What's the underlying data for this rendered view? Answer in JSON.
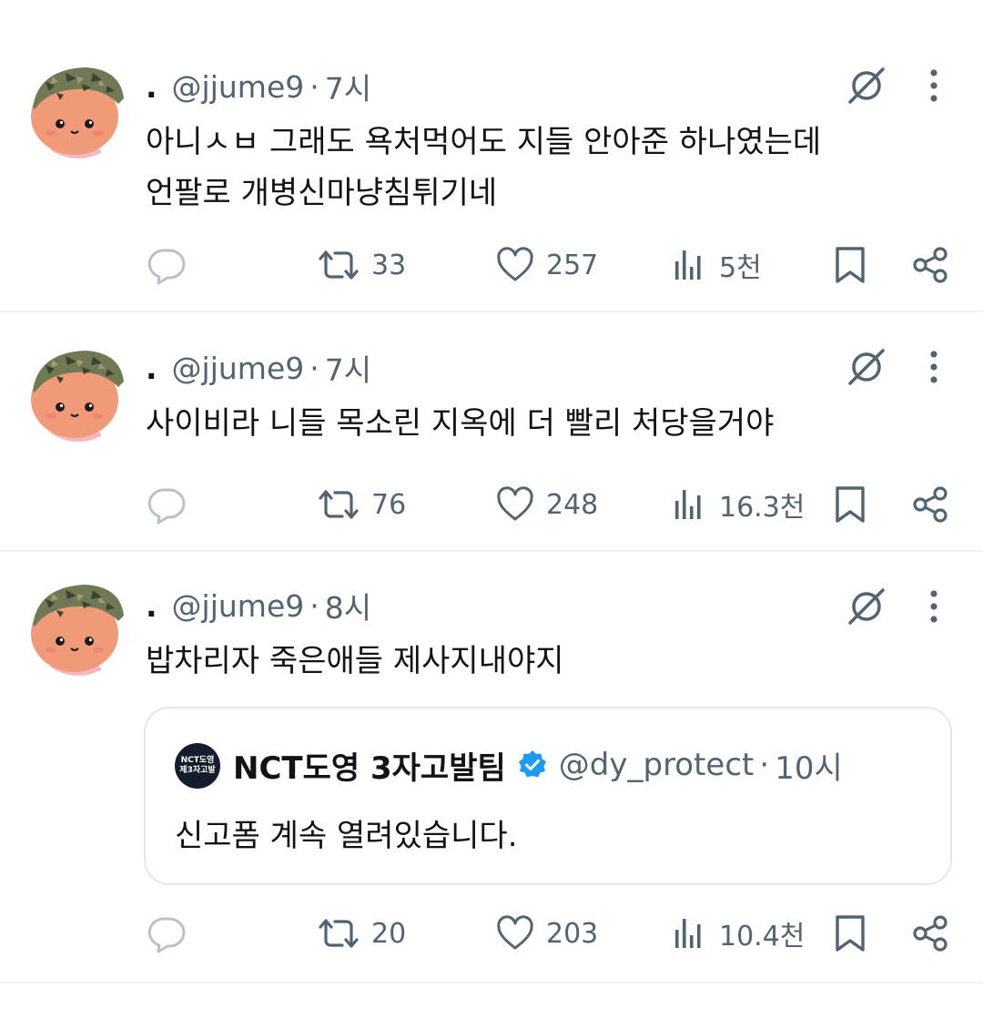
{
  "tweets": [
    {
      "display_name": ".",
      "handle": "@jjume9",
      "separator": "·",
      "time": "7시",
      "lines": [
        "아니ㅅㅂ 그래도 욕처먹어도 지들 안아준 하나였는데",
        "언팔로 개병신마냥침튀기네"
      ],
      "reply_count": "",
      "retweet_count": "33",
      "like_count": "257",
      "views_count": "5천"
    },
    {
      "display_name": ".",
      "handle": "@jjume9",
      "separator": "·",
      "time": "7시",
      "lines": [
        "사이비라 니들 목소린 지옥에 더 빨리 처당을거야"
      ],
      "reply_count": "",
      "retweet_count": "76",
      "like_count": "248",
      "views_count": "16.3천"
    },
    {
      "display_name": ".",
      "handle": "@jjume9",
      "separator": "·",
      "time": "8시",
      "lines": [
        "밥차리자 죽은애들 제사지내야지"
      ],
      "quote": {
        "avatar_line1": "NCT도영",
        "avatar_line2": "제3자고발",
        "display_name": "NCT도영 3자고발팀",
        "handle": "@dy_protect",
        "separator": "·",
        "time": "10시",
        "text": "신고폼 계속 열려있습니다."
      },
      "reply_count": "",
      "retweet_count": "20",
      "like_count": "203",
      "views_count": "10.4천"
    }
  ],
  "icons": {
    "reply": "reply-icon",
    "retweet": "retweet-icon",
    "like": "heart-icon",
    "views": "views-icon",
    "bookmark": "bookmark-icon",
    "share": "share-icon",
    "grok": "grok-icon",
    "more": "more-icon",
    "verified": "verified-badge-icon"
  },
  "colors": {
    "text_primary": "#0f1419",
    "text_secondary": "#536471",
    "divider": "#eff3f4",
    "verified": "#1d9bf0",
    "avatar_skin": "#f4a27a"
  }
}
